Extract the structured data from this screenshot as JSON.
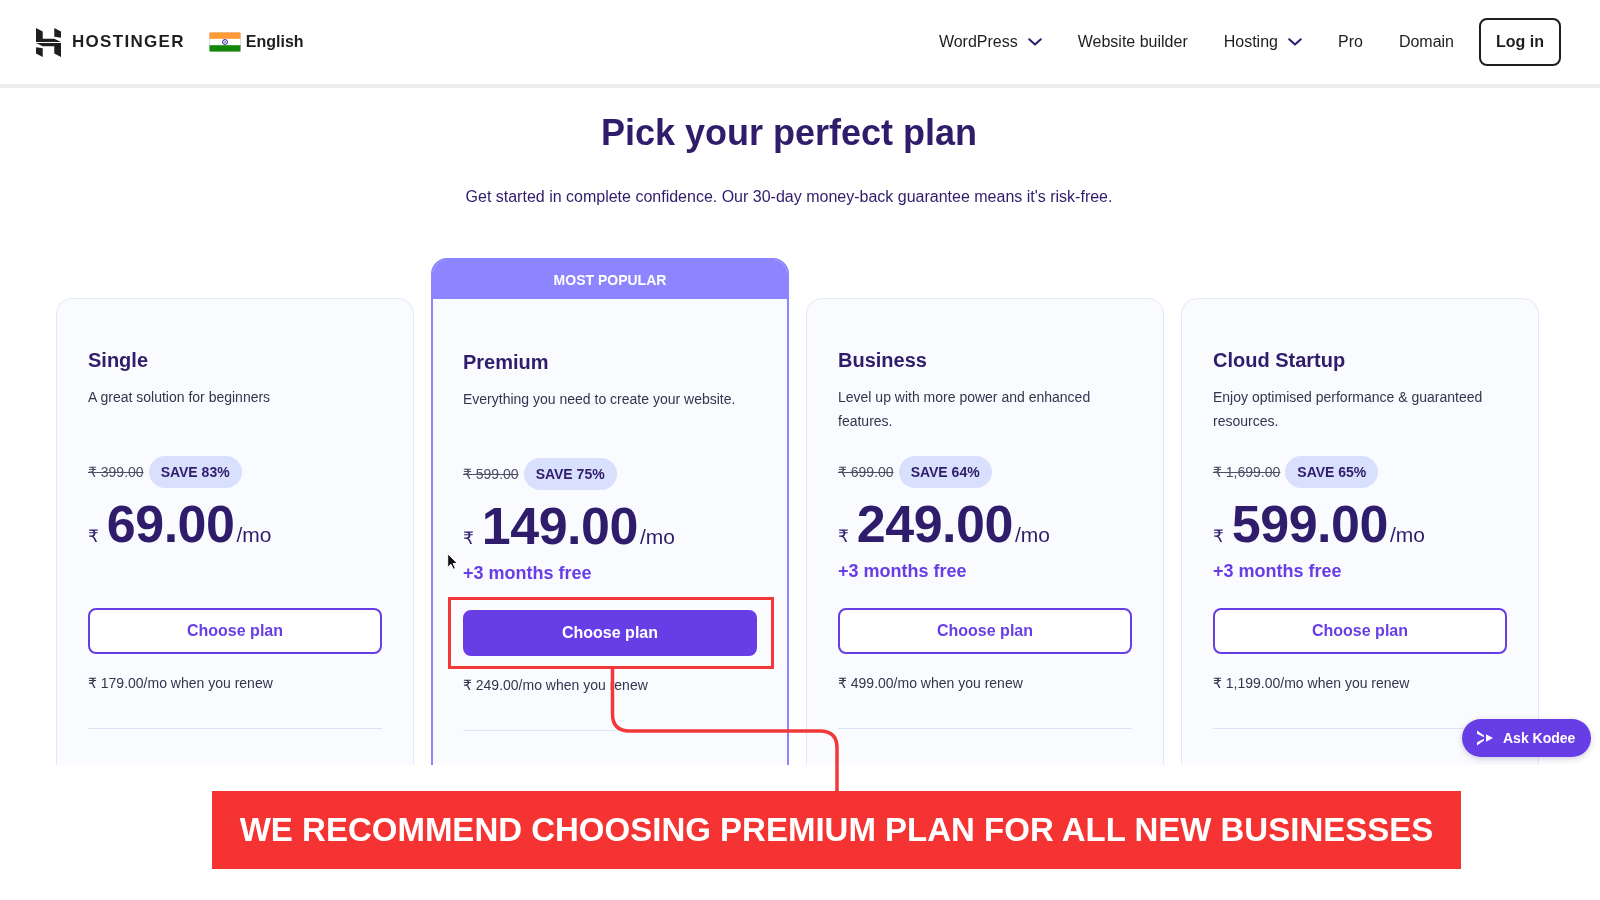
{
  "header": {
    "logo": "HOSTINGER",
    "language": "English",
    "nav": [
      {
        "label": "WordPress",
        "dropdown": true
      },
      {
        "label": "Website builder",
        "dropdown": false
      },
      {
        "label": "Hosting",
        "dropdown": true
      },
      {
        "label": "Pro",
        "dropdown": false
      },
      {
        "label": "Domain",
        "dropdown": false
      }
    ],
    "login_button": "Log in"
  },
  "hero": {
    "title": "Pick your perfect plan",
    "subtitle": "Get started in complete confidence. Our 30-day money-back guarantee means it's risk-free."
  },
  "plans": [
    {
      "name": "Single",
      "description": "A great solution for beginners",
      "old_price": "₹ 399.00",
      "save_badge": "SAVE 83%",
      "currency": "₹",
      "price": "69.00",
      "period": "/mo",
      "button": "Choose plan",
      "renewal": "₹ 179.00/mo when you renew",
      "featured": false,
      "highlighted": false
    },
    {
      "ribbon": "MOST POPULAR",
      "name": "Premium",
      "description": "Everything you need to create your website.",
      "old_price": "₹ 599.00",
      "save_badge": "SAVE 75%",
      "currency": "₹",
      "price": "149.00",
      "period": "/mo",
      "bonus": "+3 months free",
      "button": "Choose plan",
      "renewal": "₹ 249.00/mo when you renew",
      "featured": true,
      "highlighted": true
    },
    {
      "name": "Business",
      "description": "Level up with more power and enhanced features.",
      "old_price": "₹ 699.00",
      "save_badge": "SAVE 64%",
      "currency": "₹",
      "price": "249.00",
      "period": "/mo",
      "bonus": "+3 months free",
      "button": "Choose plan",
      "renewal": "₹ 499.00/mo when you renew",
      "featured": false,
      "highlighted": false
    },
    {
      "name": "Cloud Startup",
      "description": "Enjoy optimised performance & guaranteed resources.",
      "old_price": "₹ 1,699.00",
      "save_badge": "SAVE 65%",
      "currency": "₹",
      "price": "599.00",
      "period": "/mo",
      "bonus": "+3 months free",
      "button": "Choose plan",
      "renewal": "₹ 1,199.00/mo when you renew",
      "featured": false,
      "highlighted": false
    }
  ],
  "chat_button": "Ask Kodee",
  "annotation": {
    "banner": "WE RECOMMEND CHOOSING PREMIUM PLAN FOR ALL NEW BUSINESSES"
  }
}
